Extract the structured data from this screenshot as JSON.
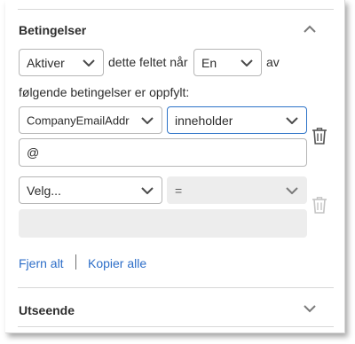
{
  "conditions": {
    "title": "Betingelser",
    "action_select": {
      "value": "Aktiver"
    },
    "text_middle": "dette feltet når",
    "match_select": {
      "value": "En"
    },
    "text_after": "av",
    "text_line2": "følgende betingelser er oppfylt:",
    "rules": [
      {
        "field": "CompanyEmailAddr",
        "operator": "inneholder",
        "value": "@",
        "disabled": false
      },
      {
        "field": "Velg...",
        "operator": "=",
        "value": "",
        "disabled": true
      }
    ],
    "remove_all_label": "Fjern alt",
    "copy_all_label": "Kopier alle"
  },
  "appearance": {
    "title": "Utseende"
  },
  "icons": {
    "collapse": "chevron-up-icon",
    "expand": "chevron-down-icon",
    "delete": "trash-icon",
    "dropdown": "chevron-down-icon"
  },
  "colors": {
    "link": "#2d6ec8",
    "focus_border": "#2d73c8",
    "disabled_bg": "#ededed",
    "border": "#b6b6b6",
    "divider": "#d7d7d7"
  }
}
